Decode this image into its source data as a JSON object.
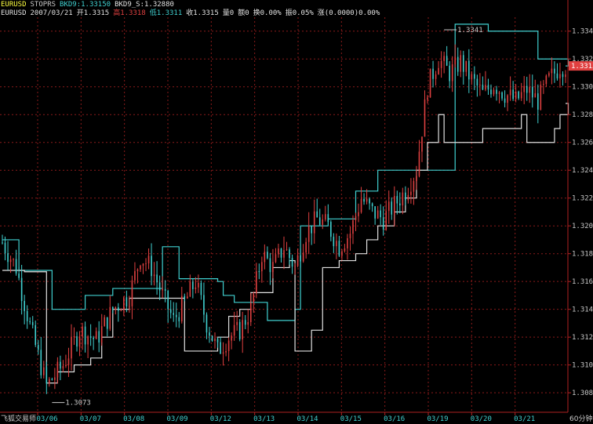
{
  "header": {
    "line1": {
      "symbol": "EURUSD",
      "indicator": "STOPRS",
      "bkd9": "BKD9:1.33150",
      "bkd9s": "BKD9_S:1.32880"
    },
    "line2": {
      "symbol": "EURUSD",
      "date": "2007/03/21",
      "open": "开1.3315",
      "high": "高1.3318",
      "low": "低1.3311",
      "close": "收1.3315",
      "volume": "量0",
      "amount": "额0",
      "turnover": "换0.00%",
      "amplitude": "振0.05%",
      "change": "涨(0.0000)0.00%"
    }
  },
  "footer": {
    "brand": "飞狐交易师",
    "period": "60分钟"
  },
  "colors": {
    "background": "#000000",
    "grid": "#8b1a1a",
    "axis": "#b22222",
    "up": "#e04040",
    "down": "#40d0d0",
    "upper_stop": "#40d0d0",
    "lower_stop": "#e0e0e0",
    "label": "#c8c8c8",
    "yellow": "#ffff40",
    "price_tag": "#e04040"
  },
  "chart_data": {
    "type": "candlestick",
    "title": "",
    "y_ticks": [
      "1.3340",
      "1.3320",
      "1.3300",
      "1.3280",
      "1.3260",
      "1.3240",
      "1.3220",
      "1.3200",
      "1.3180",
      "1.3160",
      "1.3140",
      "1.3120",
      "1.3100",
      "1.3080"
    ],
    "ylim": [
      1.3066,
      1.335
    ],
    "x_labels": [
      "03/06",
      "03/07",
      "03/08",
      "03/09",
      "03/12",
      "03/13",
      "03/14",
      "03/15",
      "03/16",
      "03/19",
      "03/20",
      "03/21"
    ],
    "bar_count": 205,
    "annotations": [
      {
        "text": "1.3341",
        "value": 1.3341,
        "at_bar": 160
      },
      {
        "text": "1.3073",
        "value": 1.3073,
        "at_bar": 18
      }
    ],
    "last_price": "1.3315",
    "price_path": [
      [
        0,
        1.3188
      ],
      [
        5,
        1.317
      ],
      [
        10,
        1.3128
      ],
      [
        16,
        1.3085
      ],
      [
        22,
        1.31
      ],
      [
        28,
        1.3125
      ],
      [
        34,
        1.3118
      ],
      [
        40,
        1.314
      ],
      [
        46,
        1.315
      ],
      [
        50,
        1.3178
      ],
      [
        54,
        1.317
      ],
      [
        58,
        1.315
      ],
      [
        62,
        1.3132
      ],
      [
        66,
        1.3145
      ],
      [
        70,
        1.316
      ],
      [
        74,
        1.313
      ],
      [
        78,
        1.311
      ],
      [
        82,
        1.312
      ],
      [
        86,
        1.3125
      ],
      [
        90,
        1.314
      ],
      [
        94,
        1.318
      ],
      [
        98,
        1.317
      ],
      [
        102,
        1.3185
      ],
      [
        106,
        1.317
      ],
      [
        110,
        1.3195
      ],
      [
        114,
        1.3205
      ],
      [
        118,
        1.32
      ],
      [
        122,
        1.3185
      ],
      [
        126,
        1.3195
      ],
      [
        130,
        1.322
      ],
      [
        134,
        1.321
      ],
      [
        138,
        1.3205
      ],
      [
        142,
        1.3215
      ],
      [
        146,
        1.3225
      ],
      [
        150,
        1.324
      ],
      [
        154,
        1.33
      ],
      [
        158,
        1.332
      ],
      [
        162,
        1.331
      ],
      [
        166,
        1.3318
      ],
      [
        170,
        1.3305
      ],
      [
        174,
        1.3295
      ],
      [
        178,
        1.3302
      ],
      [
        182,
        1.3295
      ],
      [
        186,
        1.329
      ],
      [
        190,
        1.3298
      ],
      [
        194,
        1.329
      ],
      [
        198,
        1.3305
      ],
      [
        202,
        1.3315
      ],
      [
        205,
        1.3315
      ]
    ],
    "series": [
      {
        "name": "BKD9",
        "steps": [
          [
            0,
            1.319
          ],
          [
            6,
            1.3168
          ],
          [
            18,
            1.314
          ],
          [
            30,
            1.315
          ],
          [
            40,
            1.3155
          ],
          [
            58,
            1.3185
          ],
          [
            64,
            1.3162
          ],
          [
            78,
            1.316
          ],
          [
            80,
            1.315
          ],
          [
            84,
            1.3145
          ],
          [
            96,
            1.3132
          ],
          [
            106,
            1.314
          ],
          [
            108,
            1.32
          ],
          [
            118,
            1.3205
          ],
          [
            128,
            1.3225
          ],
          [
            136,
            1.324
          ],
          [
            148,
            1.324
          ],
          [
            164,
            1.3345
          ],
          [
            176,
            1.334
          ],
          [
            194,
            1.332
          ],
          [
            200,
            1.332
          ],
          [
            205,
            1.3315
          ]
        ]
      },
      {
        "name": "BKD9_S",
        "steps": [
          [
            0,
            1.3168
          ],
          [
            8,
            1.3167
          ],
          [
            16,
            1.3087
          ],
          [
            20,
            1.3095
          ],
          [
            26,
            1.31
          ],
          [
            32,
            1.3105
          ],
          [
            36,
            1.312
          ],
          [
            40,
            1.314
          ],
          [
            46,
            1.3148
          ],
          [
            62,
            1.3148
          ],
          [
            66,
            1.311
          ],
          [
            70,
            1.311
          ],
          [
            78,
            1.312
          ],
          [
            82,
            1.3135
          ],
          [
            86,
            1.314
          ],
          [
            90,
            1.3152
          ],
          [
            98,
            1.317
          ],
          [
            104,
            1.3175
          ],
          [
            106,
            1.311
          ],
          [
            112,
            1.3125
          ],
          [
            116,
            1.317
          ],
          [
            122,
            1.3175
          ],
          [
            128,
            1.318
          ],
          [
            132,
            1.319
          ],
          [
            136,
            1.32
          ],
          [
            142,
            1.321
          ],
          [
            146,
            1.322
          ],
          [
            150,
            1.324
          ],
          [
            154,
            1.326
          ],
          [
            158,
            1.328
          ],
          [
            160,
            1.326
          ],
          [
            170,
            1.326
          ],
          [
            174,
            1.327
          ],
          [
            180,
            1.327
          ],
          [
            188,
            1.328
          ],
          [
            190,
            1.326
          ],
          [
            200,
            1.327
          ],
          [
            202,
            1.328
          ],
          [
            205,
            1.3288
          ]
        ]
      }
    ]
  }
}
